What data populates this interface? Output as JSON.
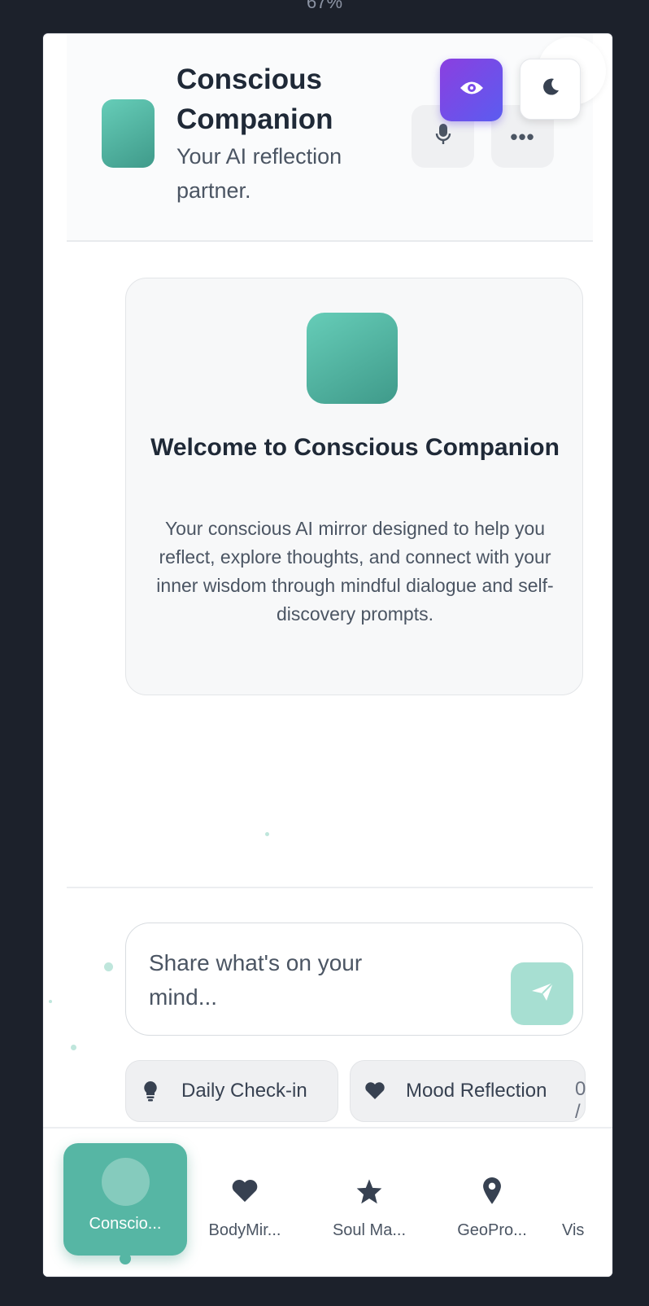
{
  "zoom_label": "67%",
  "header": {
    "title": "Conscious Companion",
    "subtitle": "Your AI reflection partner.",
    "more_label": "•••"
  },
  "welcome": {
    "title": "Welcome to Conscious Companion",
    "body": "Your conscious AI mirror designed to help you reflect, explore thoughts, and connect with your inner wisdom through mindful dialogue and self-discovery prompts."
  },
  "composer": {
    "placeholder": "Share what's on your mind..."
  },
  "chips": [
    {
      "label": "Daily Check-in",
      "icon": "lightbulb-icon"
    },
    {
      "label": "Mood Reflection",
      "icon": "heart-icon"
    }
  ],
  "counter": "0 /",
  "nav": [
    {
      "label": "Conscio...",
      "icon": "companion-icon",
      "active": true
    },
    {
      "label": "BodyMir...",
      "icon": "heart-icon"
    },
    {
      "label": "Soul Ma...",
      "icon": "star-icon"
    },
    {
      "label": "GeoPro...",
      "icon": "map-pin-icon"
    },
    {
      "label": "Vis",
      "icon": "eye-icon"
    }
  ],
  "colors": {
    "accent": "#56b6a4",
    "accent_light": "#a7dfd2",
    "purple": "#7c4dea",
    "background": "#1c212b"
  }
}
